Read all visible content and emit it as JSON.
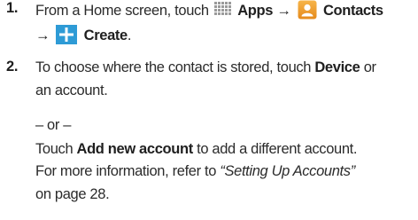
{
  "steps": [
    {
      "number": "1.",
      "line1": {
        "pre": "From a Home screen, touch",
        "apps_label": "Apps",
        "arrow1": "→",
        "contacts_label": "Contacts"
      },
      "line2": {
        "arrow2": "→",
        "create_label": "Create",
        "post": "."
      }
    },
    {
      "number": "2.",
      "line1": {
        "pre": "To choose where the contact is stored, touch",
        "device_label": "Device",
        "post": "or"
      },
      "line2": "an account.",
      "or_text": "– or –",
      "line3": {
        "pre": "Touch",
        "add_account_label": "Add new account",
        "post": "to add a different account."
      },
      "line4": {
        "pre": "For more information, refer to",
        "ref_title": "“Setting Up Accounts”"
      },
      "line5": "on page 28."
    }
  ],
  "icons": {
    "apps": "apps-grid-icon",
    "contacts": "contacts-icon",
    "create": "create-plus-icon"
  },
  "colors": {
    "apps_dots": "#9a9a9a",
    "contacts_bg": "#f0a030",
    "create_bg": "#2e9bd6"
  }
}
